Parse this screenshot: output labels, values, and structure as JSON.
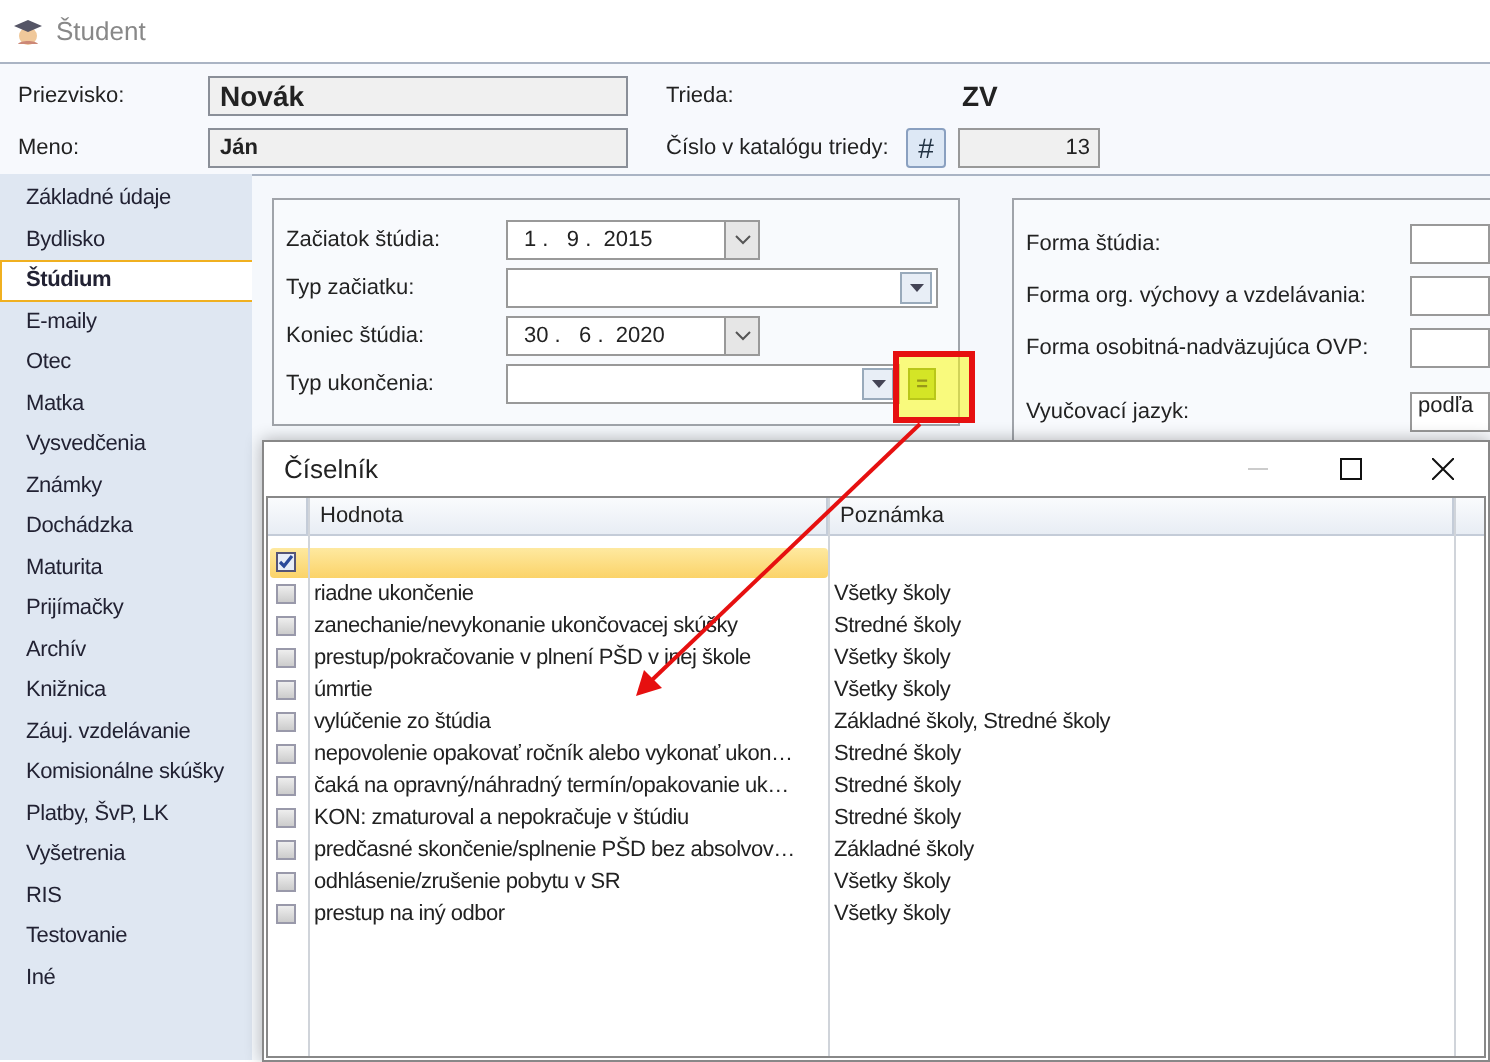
{
  "window": {
    "title": "Študent"
  },
  "student": {
    "surname_label": "Priezvisko:",
    "surname": "Novák",
    "name_label": "Meno:",
    "name": "Ján",
    "class_label": "Trieda:",
    "class": "ZV",
    "catalog_label": "Číslo v katalógu triedy:",
    "catalog_button": "#",
    "catalog_number": "13"
  },
  "sidebar": {
    "items": [
      {
        "label": "Základné údaje",
        "selected": false
      },
      {
        "label": "Bydlisko",
        "selected": false
      },
      {
        "label": "Štúdium",
        "selected": true
      },
      {
        "label": "E-maily",
        "selected": false
      },
      {
        "label": "Otec",
        "selected": false
      },
      {
        "label": "Matka",
        "selected": false
      },
      {
        "label": "Vysvedčenia",
        "selected": false
      },
      {
        "label": "Známky",
        "selected": false
      },
      {
        "label": "Dochádzka",
        "selected": false
      },
      {
        "label": "Maturita",
        "selected": false
      },
      {
        "label": "Prijímačky",
        "selected": false
      },
      {
        "label": "Archív",
        "selected": false
      },
      {
        "label": "Knižnica",
        "selected": false
      },
      {
        "label": "Záuj. vzdelávanie",
        "selected": false
      },
      {
        "label": "Komisionálne skúšky",
        "selected": false
      },
      {
        "label": "Platby, ŠvP, LK",
        "selected": false
      },
      {
        "label": "Vyšetrenia",
        "selected": false
      },
      {
        "label": "RIS",
        "selected": false
      },
      {
        "label": "Testovanie",
        "selected": false
      },
      {
        "label": "Iné",
        "selected": false
      }
    ]
  },
  "study_form": {
    "fields": [
      {
        "label": "Začiatok štúdia:",
        "kind": "date",
        "value": "1 .   9 .  2015"
      },
      {
        "label": "Typ začiatku:",
        "kind": "combo"
      },
      {
        "label": "Koniec štúdia:",
        "kind": "date",
        "value": "30 .   6 .  2020"
      },
      {
        "label": "Typ ukončenia:",
        "kind": "lookup",
        "button": "="
      }
    ]
  },
  "other_form": {
    "fields": [
      {
        "label": "Forma štúdia:"
      },
      {
        "label": "Forma org. výchovy a vzdelávania:"
      },
      {
        "label": "Forma osobitná-nadväzujúca OVP:"
      },
      {
        "label": "Vyučovací jazyk:",
        "value": "podľa"
      }
    ]
  },
  "dialog": {
    "title": "Číselník",
    "columns": [
      "Hodnota",
      "Poznámka"
    ],
    "rows": [
      {
        "value": "",
        "note": "",
        "checked": true,
        "selected": true
      },
      {
        "value": "riadne ukončenie",
        "note": "Všetky školy",
        "checked": false,
        "selected": false
      },
      {
        "value": "zanechanie/nevykonanie ukončovacej skúšky",
        "note": "Stredné školy",
        "checked": false,
        "selected": false
      },
      {
        "value": "prestup/pokračovanie v plnení PŠD v inej škole",
        "note": "Všetky školy",
        "checked": false,
        "selected": false
      },
      {
        "value": "úmrtie",
        "note": "Všetky školy",
        "checked": false,
        "selected": false
      },
      {
        "value": "vylúčenie zo štúdia",
        "note": "Základné školy, Stredné školy",
        "checked": false,
        "selected": false
      },
      {
        "value": "nepovolenie opakovať ročník alebo vykonať ukon…",
        "note": "Stredné školy",
        "checked": false,
        "selected": false
      },
      {
        "value": "čaká na opravný/náhradný termín/opakovanie uk…",
        "note": "Stredné školy",
        "checked": false,
        "selected": false
      },
      {
        "value": "KON: zmaturoval a nepokračuje v štúdiu",
        "note": "Stredné školy",
        "checked": false,
        "selected": false
      },
      {
        "value": "predčasné skončenie/splnenie PŠD bez absolvov…",
        "note": "Základné školy",
        "checked": false,
        "selected": false
      },
      {
        "value": "odhlásenie/zrušenie pobytu v SR",
        "note": "Všetky školy",
        "checked": false,
        "selected": false
      },
      {
        "value": "prestup na iný odbor",
        "note": "Všetky školy",
        "checked": false,
        "selected": false
      }
    ]
  }
}
